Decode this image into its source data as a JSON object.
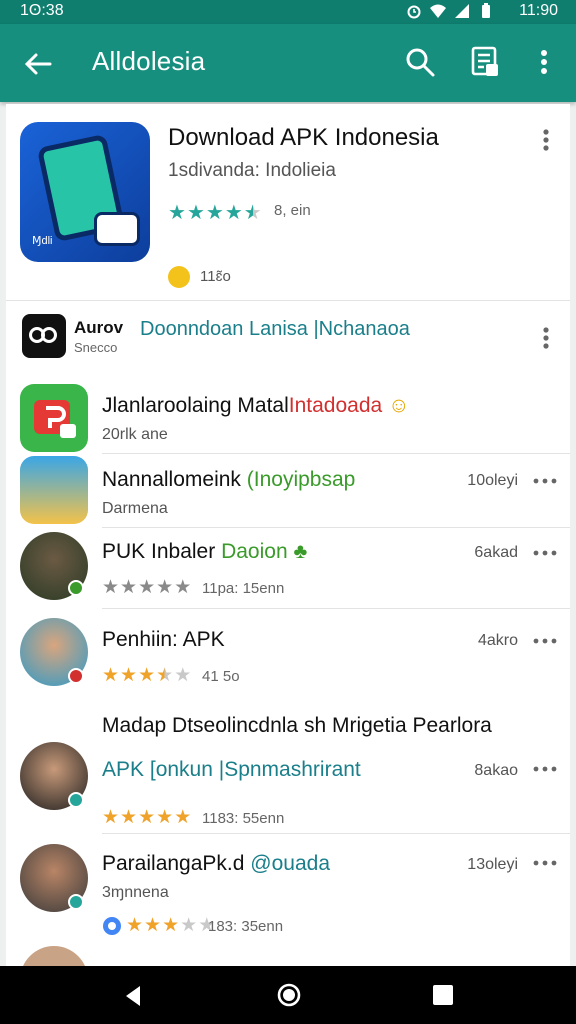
{
  "status_bar": {
    "time_left": "1ʘ:38",
    "time_right": "11:90"
  },
  "app_bar": {
    "title": "Alldolesia"
  },
  "featured": {
    "title": "Download APK Indonesia",
    "subtitle": "1sdivanda: Indolieia",
    "rating": 4.5,
    "rating_count": "8, ein",
    "icon_label": "Ɱdli",
    "badge_text": "11ɛ̃o"
  },
  "sponsor": {
    "brand": "Aurov",
    "brand_sub": "Snecco",
    "title": "Doonndoan Lanisa |Nchanaoa"
  },
  "apps": [
    {
      "title": "Jlanlaroolaing Matal",
      "title_accent": "Intadoada",
      "subtitle": "20rlk ane"
    },
    {
      "title": "Nannallomeink",
      "title_accent": "(Inoyipbsap",
      "subtitle": "Darmena",
      "meta": "10oleyi"
    },
    {
      "title": "PUK Inbaler",
      "title_accent": "Daoion",
      "stars": 5,
      "rating_text": "11pa: 15enn",
      "meta": "6akad"
    },
    {
      "title": "Penhiin: APK",
      "stars": 3.5,
      "rating_text": "41 5o",
      "meta": "4akro"
    },
    {
      "header_text": "Madap Dtseolincdnla sh Mrigetia Pearlora",
      "title": "APK [onkun |Spnmashrirant",
      "stars": 5,
      "rating_text": "1183: 55enn",
      "meta": "8akao"
    },
    {
      "title": "ParailangaPk.d",
      "title_accent": "@ouada",
      "subtitle": "3ɱnnena",
      "stars": 3,
      "rating_text": "183: 35enn",
      "meta": "13oleyi"
    }
  ],
  "colors": {
    "status_bar": "#0f7e6f",
    "app_bar": "#178f7f",
    "star_teal": "#26a69a",
    "star_gold": "#f0a32a",
    "accent_red": "#d22f2f",
    "accent_green": "#3a9b2a",
    "accent_teal": "#1a7f8a"
  }
}
